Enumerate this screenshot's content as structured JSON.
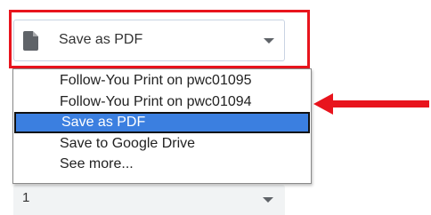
{
  "destination": {
    "selected_label": "Save as PDF",
    "icon": "document-icon"
  },
  "destination_options": [
    {
      "label": "Follow-You Print on pwc01095",
      "selected": false
    },
    {
      "label": "Follow-You Print on pwc01094",
      "selected": false
    },
    {
      "label": "Save as PDF",
      "selected": true
    },
    {
      "label": "Save to Google Drive",
      "selected": false
    },
    {
      "label": "See more...",
      "selected": false
    }
  ],
  "pages": {
    "value": "1"
  },
  "annotation": {
    "highlight_color": "#e8141d",
    "arrow_color": "#e8141d"
  }
}
